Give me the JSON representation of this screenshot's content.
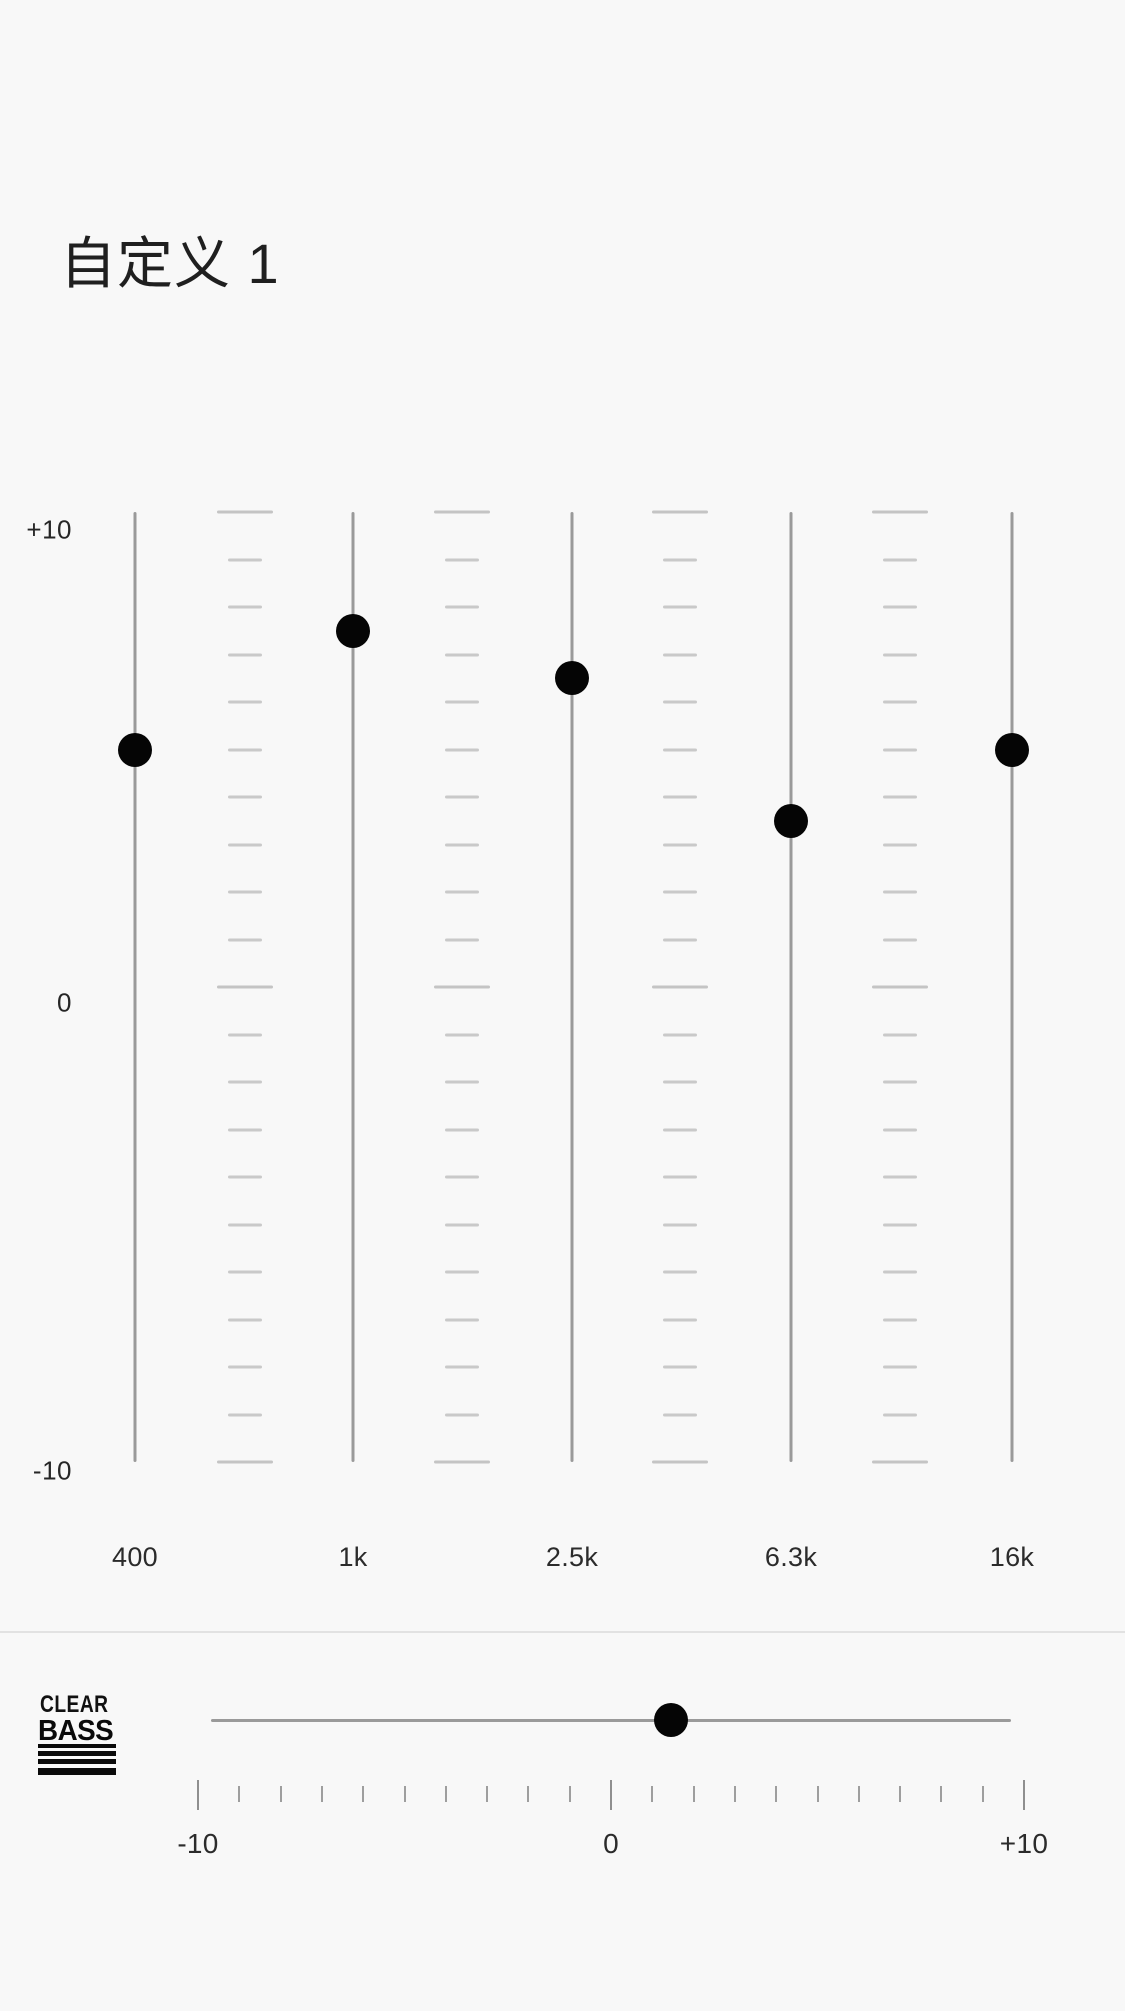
{
  "screen": {
    "title": "自定义 1",
    "background_color": "#f8f8f8",
    "accent_color": "#050505",
    "track_color": "#9a9a9a",
    "tick_color": "#c9c9c9"
  },
  "equalizer": {
    "gain_axis": {
      "max_label": "+10",
      "mid_label": "0",
      "min_label": "-10",
      "max_value": 10,
      "min_value": -10
    },
    "bands": [
      {
        "freq_label": "400",
        "value": 5.0
      },
      {
        "freq_label": "1k",
        "value": 7.5
      },
      {
        "freq_label": "2.5k",
        "value": 6.5
      },
      {
        "freq_label": "6.3k",
        "value": 3.5
      },
      {
        "freq_label": "16k",
        "value": 5.0
      }
    ]
  },
  "clear_bass": {
    "logo_top_text": "CLEAR",
    "logo_bottom_text": "BASS",
    "logo_name": "clear-bass-logo",
    "value": 1.5,
    "scale": {
      "min_label": "-10",
      "mid_label": "0",
      "max_label": "+10",
      "min_value": -10,
      "max_value": 10,
      "tick_count": 21
    }
  },
  "chart_data": {
    "type": "bar",
    "title": "自定义 1",
    "xlabel": "",
    "ylabel": "",
    "categories": [
      "400",
      "1k",
      "2.5k",
      "6.3k",
      "16k"
    ],
    "values": [
      5.0,
      7.5,
      6.5,
      3.5,
      5.0
    ],
    "ylim": [
      -10,
      10
    ],
    "ytick_labels": [
      "+10",
      "0",
      "-10"
    ],
    "grid": false,
    "legend": null,
    "annotations": [
      {
        "name": "clear-bass",
        "label": "CLEAR BASS",
        "value": 1.5,
        "range": [
          -10,
          10
        ]
      }
    ]
  }
}
